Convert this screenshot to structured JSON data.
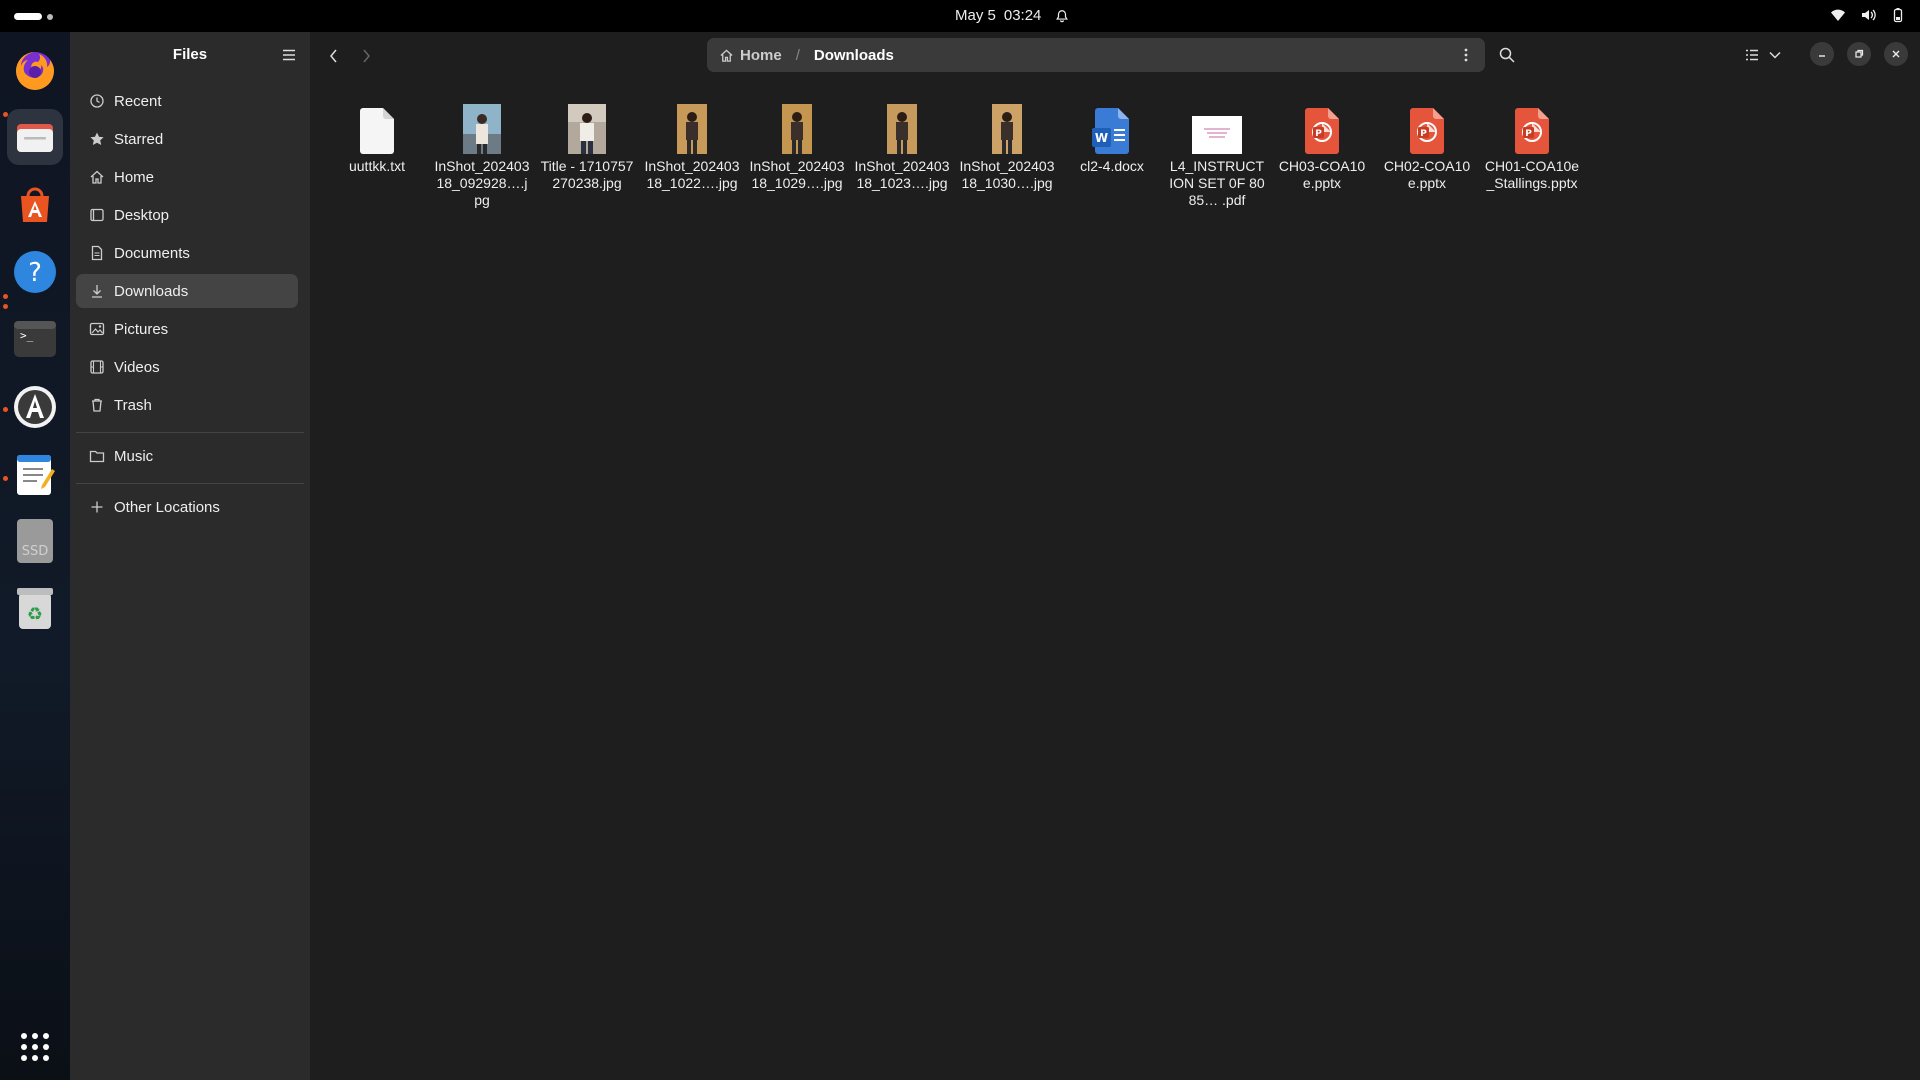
{
  "topbar": {
    "date": "May 5",
    "time": "03:24"
  },
  "window": {
    "sidebar": {
      "title": "Files",
      "places": [
        {
          "label": "Recent",
          "icon": "clock-icon"
        },
        {
          "label": "Starred",
          "icon": "star-icon"
        },
        {
          "label": "Home",
          "icon": "home-icon"
        },
        {
          "label": "Desktop",
          "icon": "desktop-icon"
        },
        {
          "label": "Documents",
          "icon": "documents-icon"
        },
        {
          "label": "Downloads",
          "icon": "download-icon"
        },
        {
          "label": "Pictures",
          "icon": "pictures-icon"
        },
        {
          "label": "Videos",
          "icon": "videos-icon"
        },
        {
          "label": "Trash",
          "icon": "trash-icon"
        }
      ],
      "bookmarks": [
        {
          "label": "Music",
          "icon": "folder-icon"
        }
      ],
      "other_locations": "Other Locations"
    },
    "pathbar": {
      "home": "Home",
      "current": "Downloads"
    },
    "files": [
      {
        "name": "uuttkk.txt",
        "type": "text"
      },
      {
        "name": "InShot_20240318_092928….jpg",
        "type": "image"
      },
      {
        "name": "Title - 1710757270238.jpg",
        "type": "image"
      },
      {
        "name": "InShot_20240318_1022….jpg",
        "type": "image"
      },
      {
        "name": "InShot_20240318_1029….jpg",
        "type": "image"
      },
      {
        "name": "InShot_20240318_1023….jpg",
        "type": "image"
      },
      {
        "name": "InShot_20240318_1030….jpg",
        "type": "image"
      },
      {
        "name": "cl2-4.docx",
        "type": "docx"
      },
      {
        "name": "L4_INSTRUCTION SET 0F 8085… .pdf",
        "type": "pdf"
      },
      {
        "name": "CH03-COA10e.pptx",
        "type": "pptx"
      },
      {
        "name": "CH02-COA10e.pptx",
        "type": "pptx"
      },
      {
        "name": "CH01-COA10e_Stallings.pptx",
        "type": "pptx"
      }
    ]
  },
  "dock": {
    "apps": [
      "firefox-icon",
      "files-icon",
      "app-center-icon",
      "help-icon",
      "terminal-icon",
      "software-updater-icon",
      "text-editor-icon",
      "ssd-drive-icon",
      "trash-bin-icon",
      "show-apps-icon"
    ],
    "ssd_label": "SSD"
  },
  "colors": {
    "accent": "#e95420",
    "sidebar_bg": "#2b2b2b",
    "content_bg": "#1e1e1e"
  }
}
